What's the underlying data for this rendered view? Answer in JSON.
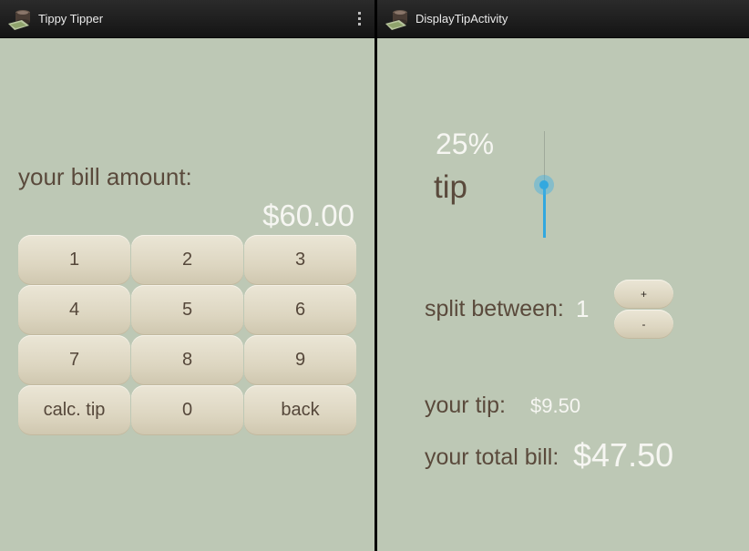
{
  "left_screen": {
    "app_title": "Tippy Tipper",
    "app_icon": "tip-jar-icon",
    "overflow_icon": "overflow-menu-icon",
    "bill_label": "your bill amount:",
    "bill_amount": "$60.00",
    "keypad": [
      "1",
      "2",
      "3",
      "4",
      "5",
      "6",
      "7",
      "8",
      "9",
      "calc. tip",
      "0",
      "back"
    ]
  },
  "right_screen": {
    "app_title": "DisplayTipActivity",
    "app_icon": "tip-jar-icon",
    "tip_percent": "25%",
    "tip_label": "tip",
    "tip_slider_fraction": 0.5,
    "split_label": "split between:",
    "split_count": "1",
    "plus_label": "+",
    "minus_label": "-",
    "your_tip_label": "your tip:",
    "your_tip_value": "$9.50",
    "total_label": "your total bill:",
    "total_value": "$47.50"
  },
  "colors": {
    "background": "#bdc8b5",
    "action_bar": "#1c1c1c",
    "label_text": "#5a4a3c",
    "value_text": "#f6f6f2",
    "key_face": "#ddd6c1",
    "accent": "#33a8df"
  }
}
